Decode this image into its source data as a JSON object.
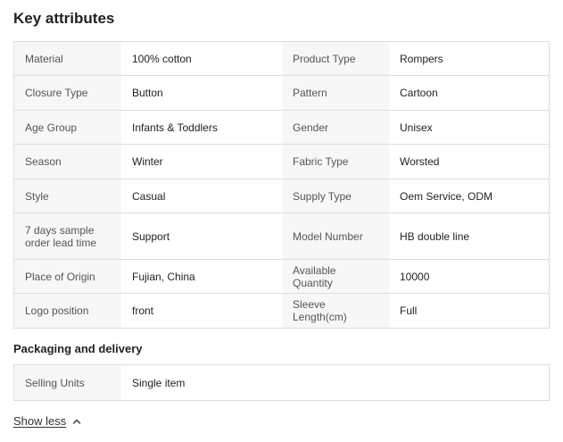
{
  "key_attributes": {
    "title": "Key attributes",
    "rows": [
      {
        "k1": "Material",
        "v1": "100% cotton",
        "k2": "Product Type",
        "v2": "Rompers"
      },
      {
        "k1": "Closure Type",
        "v1": "Button",
        "k2": "Pattern",
        "v2": "Cartoon"
      },
      {
        "k1": "Age Group",
        "v1": "Infants & Toddlers",
        "k2": "Gender",
        "v2": "Unisex"
      },
      {
        "k1": "Season",
        "v1": "Winter",
        "k2": "Fabric Type",
        "v2": "Worsted"
      },
      {
        "k1": "Style",
        "v1": "Casual",
        "k2": "Supply Type",
        "v2": "Oem Service, ODM"
      },
      {
        "k1": "7 days sample order lead time",
        "v1": "Support",
        "k2": "Model Number",
        "v2": "HB double line"
      },
      {
        "k1": "Place of Origin",
        "v1": "Fujian, China",
        "k2": "Available Quantity",
        "v2": "10000"
      },
      {
        "k1": "Logo position",
        "v1": "front",
        "k2": "Sleeve Length(cm)",
        "v2": "Full"
      }
    ]
  },
  "packaging": {
    "title": "Packaging and delivery",
    "rows": [
      {
        "k1": "Selling Units",
        "v1": "Single item"
      }
    ]
  },
  "toggle": {
    "label": "Show less",
    "icon": "chevron-up-icon"
  }
}
